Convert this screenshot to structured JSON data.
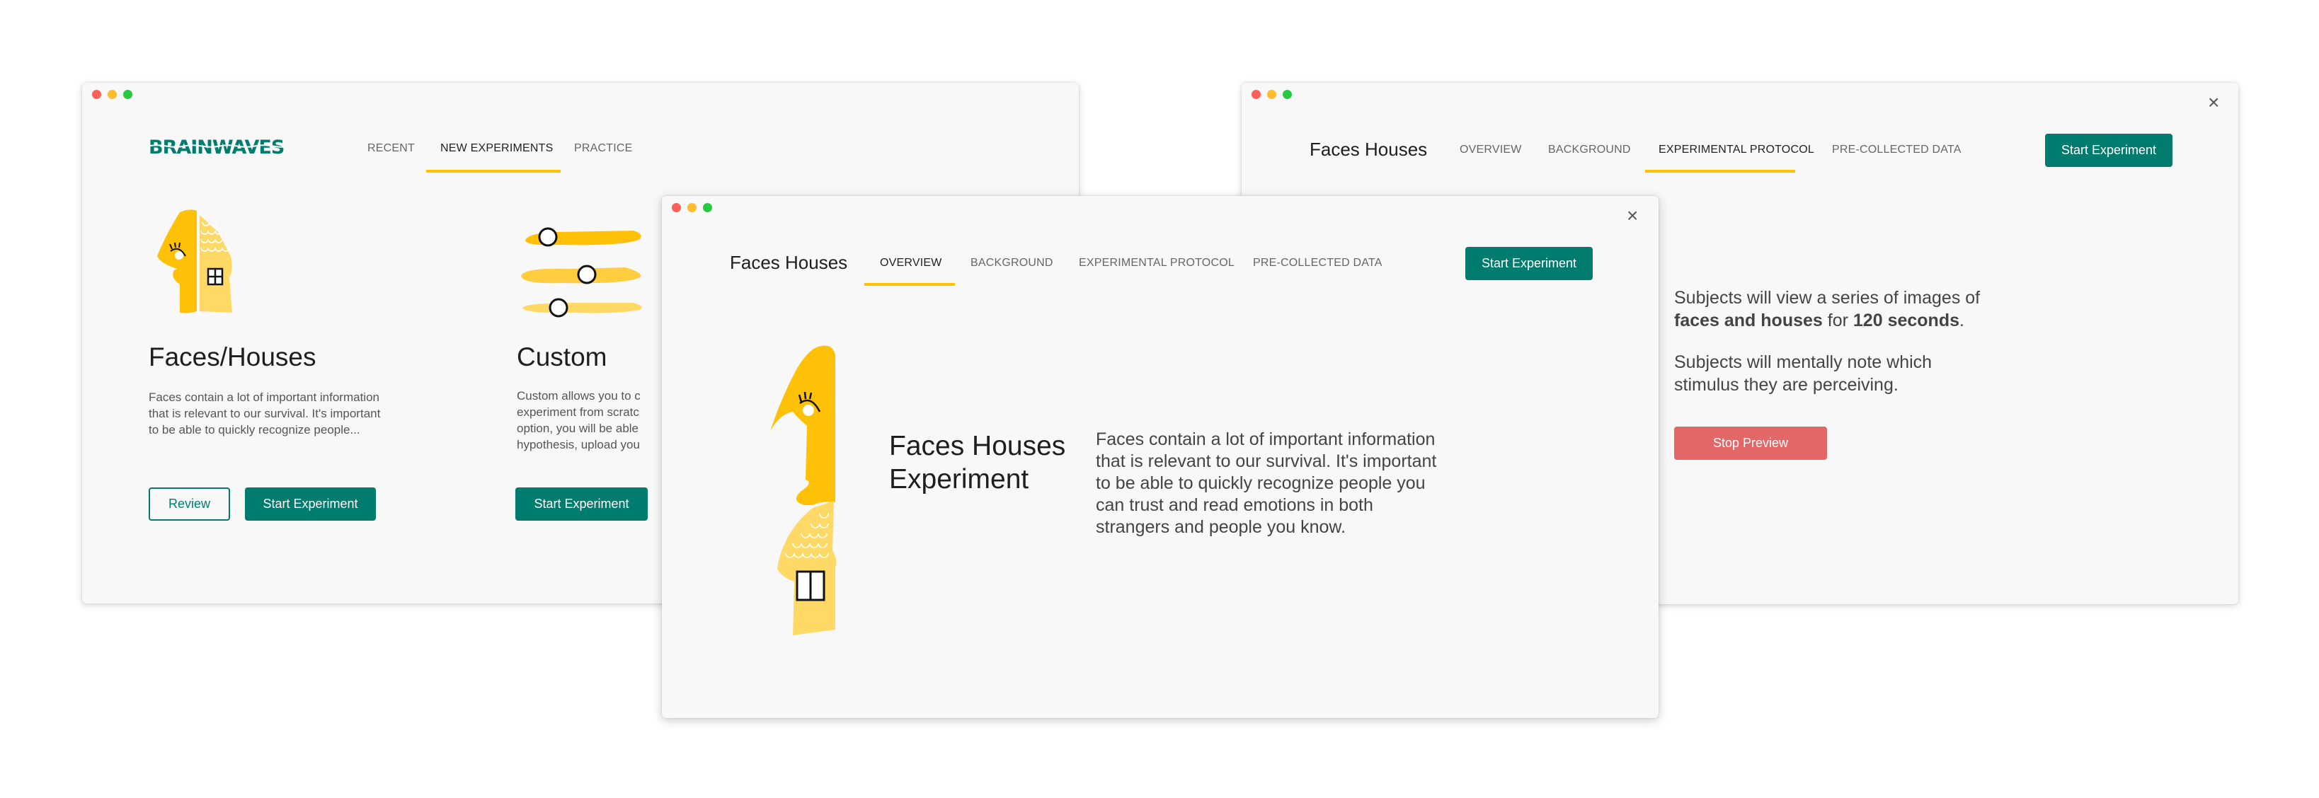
{
  "colors": {
    "brand": "#007c6e",
    "accent": "#ffc107",
    "danger": "#e26767",
    "window_bg": "#f8f8f8"
  },
  "left_window": {
    "logo": "BRAINWAVES",
    "nav": [
      {
        "label": "RECENT",
        "active": false
      },
      {
        "label": "NEW EXPERIMENTS",
        "active": true
      },
      {
        "label": "PRACTICE",
        "active": false
      }
    ],
    "cards": [
      {
        "icon": "face-house-icon",
        "title": "Faces/Houses",
        "description": "Faces contain a lot of important information that is relevant to our survival. It's important to be able to quickly recognize people...",
        "buttons": [
          "Review",
          "Start Experiment"
        ]
      },
      {
        "icon": "sliders-icon",
        "title": "Custom",
        "description": "Custom allows you to c experiment from scratc option, you will be able hypothesis, upload you",
        "description_lines": [
          "Custom allows you to c",
          "experiment from scratc",
          "option, you will be able",
          "hypothesis, upload you"
        ],
        "buttons": [
          "Start Experiment"
        ]
      }
    ]
  },
  "middle_window": {
    "title": "Faces Houses",
    "tabs": [
      {
        "label": "OVERVIEW",
        "active": true
      },
      {
        "label": "BACKGROUND",
        "active": false
      },
      {
        "label": "EXPERIMENTAL PROTOCOL",
        "active": false
      },
      {
        "label": "PRE-COLLECTED DATA",
        "active": false
      }
    ],
    "start_button": "Start Experiment",
    "close_icon": "×",
    "heading_line1": "Faces Houses",
    "heading_line2": "Experiment",
    "description": "Faces contain a lot of important information that is relevant to our survival. It's important to be able to quickly recognize people you can trust and read emotions in both strangers and people you know."
  },
  "right_window": {
    "title": "Faces Houses",
    "tabs": [
      {
        "label": "OVERVIEW",
        "active": false
      },
      {
        "label": "BACKGROUND",
        "active": false
      },
      {
        "label": "EXPERIMENTAL PROTOCOL",
        "active": true
      },
      {
        "label": "PRE-COLLECTED DATA",
        "active": false
      }
    ],
    "start_button": "Start Experiment",
    "close_icon": "×",
    "protocol": {
      "p1_prefix": "Subjects will view a series of images of",
      "p1_bold1": "faces and houses",
      "p1_mid": "for",
      "p1_bold2": "120 seconds",
      "p1_suffix": ".",
      "p2": "Subjects will mentally note which stimulus they are perceiving."
    },
    "stop_button": "Stop Preview"
  }
}
